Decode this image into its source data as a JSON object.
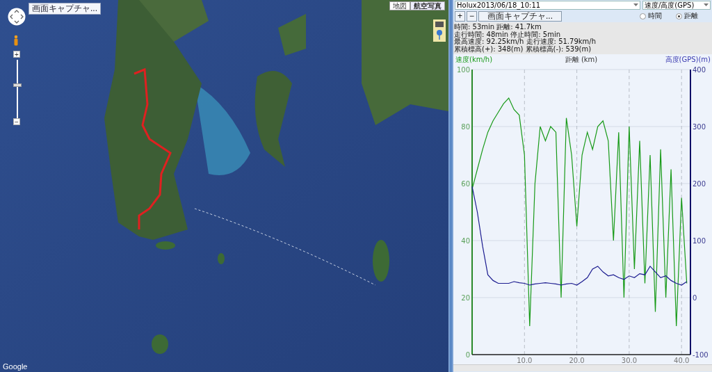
{
  "map": {
    "capture_button": "画面キャプチャ...",
    "zoom": {
      "in": "+",
      "out": "−",
      "level": 0.57
    },
    "map_types": [
      {
        "label": "地図",
        "selected": false
      },
      {
        "label": "航空写真",
        "selected": true
      }
    ],
    "logo": "Google"
  },
  "panel": {
    "track_select": "Holux2013/06/18_10:11",
    "graph_select": "速度/高度(GPS)",
    "toolbar": {
      "add": "+",
      "remove": "−",
      "capture": "画面キャプチャ..."
    },
    "x_axis_options": [
      {
        "label": "時間",
        "selected": false
      },
      {
        "label": "距離",
        "selected": true
      }
    ],
    "stats": [
      "時間: 53min 距離: 41.7km",
      "走行時間: 48min 停止時間: 5min",
      "最高速度: 92.25km/h 走行速度: 51.79km/h",
      "累積標高(+): 348(m) 累積標高(-): 539(m)"
    ],
    "speed_graph": {
      "chart_data": {
        "type": "line",
        "xlabel": "距離 (km)",
        "ylabel": "速度(km/h)",
        "grid": true,
        "x": [
          0,
          1,
          2,
          3,
          4,
          5,
          6,
          7,
          8,
          9,
          10,
          11,
          12,
          13,
          14,
          15,
          16,
          17,
          18,
          19,
          20,
          21,
          22,
          23,
          24,
          25,
          26,
          27,
          28,
          29,
          30,
          31,
          32,
          33,
          34,
          35,
          36,
          37,
          38,
          39,
          40,
          41
        ],
        "series": [
          {
            "color": "#189a18",
            "values": [
              58,
              65,
              72,
              78,
              82,
              85,
              88,
              90,
              86,
              84,
              70,
              10,
              60,
              80,
              75,
              80,
              78,
              20,
              83,
              70,
              45,
              70,
              78,
              72,
              80,
              82,
              75,
              40,
              78,
              20,
              80,
              30,
              75,
              25,
              70,
              15,
              72,
              20,
              65,
              10,
              55,
              25
            ]
          }
        ],
        "xlim": [
          0,
          41.7
        ],
        "ylim": [
          0,
          100
        ],
        "xticks": [
          {
            "value": 10,
            "label": "10.0"
          },
          {
            "value": 20,
            "label": "20.0"
          },
          {
            "value": 30,
            "label": "30.0"
          },
          {
            "value": 40,
            "label": "40.0"
          }
        ],
        "yticks": [
          0,
          20,
          40,
          60,
          80,
          100
        ]
      }
    },
    "altitude_graph": {
      "chart_data": {
        "type": "line",
        "ylabel": "高度(GPS)(m)",
        "x": [
          0,
          1,
          2,
          3,
          4,
          5,
          6,
          7,
          8,
          9,
          10,
          11,
          12,
          13,
          14,
          15,
          16,
          17,
          18,
          19,
          20,
          21,
          22,
          23,
          24,
          25,
          26,
          27,
          28,
          29,
          30,
          31,
          32,
          33,
          34,
          35,
          36,
          37,
          38,
          39,
          40,
          41
        ],
        "series": [
          {
            "color": "#1c1c90",
            "values": [
              195,
              150,
              90,
              40,
              30,
              25,
              25,
              25,
              28,
              26,
              25,
              22,
              24,
              25,
              26,
              25,
              24,
              22,
              24,
              25,
              22,
              28,
              35,
              50,
              55,
              45,
              38,
              40,
              35,
              32,
              38,
              35,
              42,
              40,
              55,
              45,
              35,
              38,
              30,
              25,
              22,
              28
            ]
          }
        ],
        "xlim": [
          0,
          41.7
        ],
        "ylim": [
          -100,
          400
        ],
        "yticks": [
          -100,
          0,
          100,
          200,
          300,
          400
        ]
      }
    }
  }
}
